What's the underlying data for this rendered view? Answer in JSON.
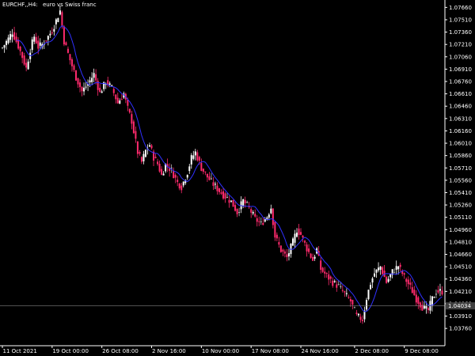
{
  "header": {
    "symbol_timeframe": "EURCHF,,H4:",
    "description": "euro vs Swiss franc"
  },
  "colors": {
    "background": "#000000",
    "axis": "#ffffff",
    "candle_bull": "#ffffff",
    "candle_bear": "#ff2a6d",
    "candle_neutral": "#c0c0c0",
    "ma_line": "#3030ff",
    "price_label_bg": "#404040"
  },
  "current_price": {
    "label": "1.04034",
    "value": 1.04034
  },
  "chart_data": {
    "type": "candlestick",
    "title": "EURCHF,,H4:  euro vs Swiss franc",
    "ylim": [
      1.0355,
      1.0775
    ],
    "y_ticks": [
      {
        "value": 1.0766,
        "label": "1.07660"
      },
      {
        "value": 1.0751,
        "label": "1.07510"
      },
      {
        "value": 1.0736,
        "label": "1.07360"
      },
      {
        "value": 1.0721,
        "label": "1.07210"
      },
      {
        "value": 1.0706,
        "label": "1.07060"
      },
      {
        "value": 1.0691,
        "label": "1.06910"
      },
      {
        "value": 1.0676,
        "label": "1.06760"
      },
      {
        "value": 1.0661,
        "label": "1.06610"
      },
      {
        "value": 1.0646,
        "label": "1.06460"
      },
      {
        "value": 1.0631,
        "label": "1.06310"
      },
      {
        "value": 1.0616,
        "label": "1.06160"
      },
      {
        "value": 1.0601,
        "label": "1.06010"
      },
      {
        "value": 1.0586,
        "label": "1.05860"
      },
      {
        "value": 1.0571,
        "label": "1.05710"
      },
      {
        "value": 1.0556,
        "label": "1.05560"
      },
      {
        "value": 1.0541,
        "label": "1.05410"
      },
      {
        "value": 1.0526,
        "label": "1.05260"
      },
      {
        "value": 1.0511,
        "label": "1.05110"
      },
      {
        "value": 1.0496,
        "label": "1.04960"
      },
      {
        "value": 1.0481,
        "label": "1.04810"
      },
      {
        "value": 1.0466,
        "label": "1.04660"
      },
      {
        "value": 1.0451,
        "label": "1.04510"
      },
      {
        "value": 1.0436,
        "label": "1.04360"
      },
      {
        "value": 1.0421,
        "label": "1.04210"
      },
      {
        "value": 1.0406,
        "label": "1.04060"
      },
      {
        "value": 1.0391,
        "label": "1.03910"
      },
      {
        "value": 1.0376,
        "label": "1.03760"
      }
    ],
    "x_labels": [
      {
        "label": "11 Oct 2021",
        "bar": 0
      },
      {
        "label": "19 Oct 00:00",
        "bar": 25
      },
      {
        "label": "26 Oct 08:00",
        "bar": 50
      },
      {
        "label": "2 Nov 16:00",
        "bar": 75
      },
      {
        "label": "10 Nov 00:00",
        "bar": 100
      },
      {
        "label": "17 Nov 08:00",
        "bar": 125
      },
      {
        "label": "24 Nov 16:00",
        "bar": 150
      },
      {
        "label": "2 Dec 08:00",
        "bar": 177
      },
      {
        "label": "9 Dec 08:00",
        "bar": 202
      }
    ],
    "close_anchors": [
      [
        0,
        1.0717
      ],
      [
        3,
        1.0728
      ],
      [
        5,
        1.0736
      ],
      [
        8,
        1.0719
      ],
      [
        10,
        1.0706
      ],
      [
        12,
        1.0692
      ],
      [
        14,
        1.0715
      ],
      [
        16,
        1.0731
      ],
      [
        18,
        1.0718
      ],
      [
        20,
        1.0721
      ],
      [
        22,
        1.0727
      ],
      [
        25,
        1.0738
      ],
      [
        27,
        1.075
      ],
      [
        29,
        1.0762
      ],
      [
        31,
        1.0725
      ],
      [
        34,
        1.0702
      ],
      [
        37,
        1.0681
      ],
      [
        40,
        1.0664
      ],
      [
        43,
        1.0673
      ],
      [
        46,
        1.0685
      ],
      [
        49,
        1.0662
      ],
      [
        52,
        1.0676
      ],
      [
        55,
        1.0668
      ],
      [
        58,
        1.065
      ],
      [
        61,
        1.0661
      ],
      [
        63,
        1.0643
      ],
      [
        65,
        1.0628
      ],
      [
        68,
        1.059
      ],
      [
        70,
        1.0578
      ],
      [
        72,
        1.0592
      ],
      [
        74,
        1.0599
      ],
      [
        76,
        1.0584
      ],
      [
        78,
        1.0576
      ],
      [
        80,
        1.0562
      ],
      [
        82,
        1.0575
      ],
      [
        85,
        1.0568
      ],
      [
        88,
        1.0553
      ],
      [
        90,
        1.0548
      ],
      [
        93,
        1.0566
      ],
      [
        95,
        1.0583
      ],
      [
        97,
        1.059
      ],
      [
        100,
        1.0571
      ],
      [
        103,
        1.056
      ],
      [
        106,
        1.0551
      ],
      [
        109,
        1.0543
      ],
      [
        112,
        1.0536
      ],
      [
        115,
        1.053
      ],
      [
        118,
        1.0517
      ],
      [
        121,
        1.0531
      ],
      [
        124,
        1.0522
      ],
      [
        127,
        1.0509
      ],
      [
        130,
        1.0503
      ],
      [
        133,
        1.0512
      ],
      [
        135,
        1.0523
      ],
      [
        137,
        1.0488
      ],
      [
        140,
        1.0471
      ],
      [
        143,
        1.0462
      ],
      [
        146,
        1.0481
      ],
      [
        148,
        1.0496
      ],
      [
        150,
        1.049
      ],
      [
        153,
        1.0473
      ],
      [
        156,
        1.0459
      ],
      [
        158,
        1.0472
      ],
      [
        160,
        1.0448
      ],
      [
        163,
        1.044
      ],
      [
        166,
        1.0432
      ],
      [
        169,
        1.0427
      ],
      [
        172,
        1.0418
      ],
      [
        175,
        1.0409
      ],
      [
        178,
        1.0391
      ],
      [
        181,
        1.0387
      ],
      [
        183,
        1.0413
      ],
      [
        185,
        1.0431
      ],
      [
        187,
        1.0443
      ],
      [
        190,
        1.0451
      ],
      [
        193,
        1.0432
      ],
      [
        196,
        1.0445
      ],
      [
        199,
        1.0452
      ],
      [
        202,
        1.0438
      ],
      [
        205,
        1.0426
      ],
      [
        208,
        1.0412
      ],
      [
        211,
        1.0402
      ],
      [
        214,
        1.0398
      ],
      [
        216,
        1.0412
      ],
      [
        218,
        1.0421
      ]
    ],
    "ma_period": 8
  }
}
